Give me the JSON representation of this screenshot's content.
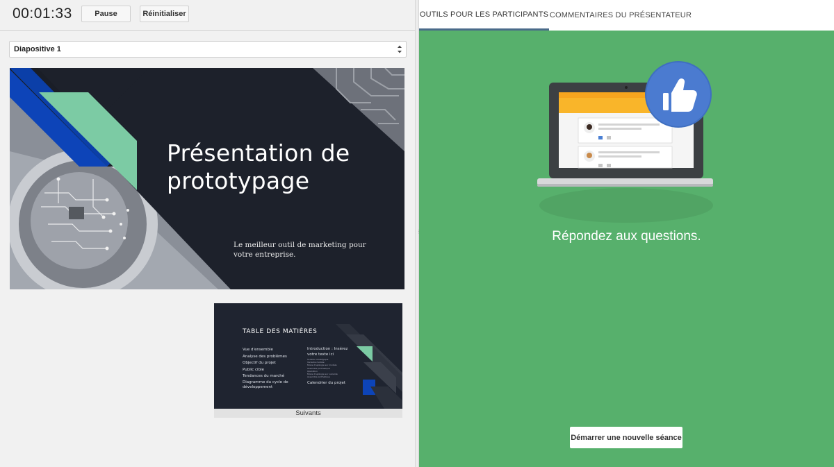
{
  "toolbar": {
    "timer": "00:01:33",
    "pause_label": "Pause",
    "reset_label": "Réinitialiser"
  },
  "slide_selector": {
    "selected": "Diapositive 1"
  },
  "current_slide": {
    "title_line1": "Présentation de",
    "title_line2": "prototypage",
    "subtitle": "Le meilleur outil de marketing pour votre entreprise."
  },
  "next_slide": {
    "title": "TABLE DES MATIÈRES",
    "col1": [
      "Vue d'ensemble",
      "Analyse des problèmes",
      "Objectif du projet",
      "Public cible",
      "Tendances du marché",
      "Diagramme du cycle de",
      "développement"
    ],
    "col2_head1": "Introduction : Insérez",
    "col2_head2": "votre texte ici",
    "col2_tiny": [
      "Solution stratégique",
      "Variante modèle",
      "Mode d'apologie sur modèle",
      "Assemble prothetique",
      "Opération",
      "Mode d'apologie sur variante",
      "Assemble prothetique"
    ],
    "col2_last": "Calendrier du projet",
    "label": "Suivants"
  },
  "tabs": {
    "tools": "OUTILS POUR LES PARTICIPANTS",
    "notes": "COMMENTAIRES DU PRÉSENTATEUR"
  },
  "participant_panel": {
    "prompt": "Répondez aux questions.",
    "start_label": "Démarrer une nouvelle séance",
    "background_color": "#57b06c"
  }
}
